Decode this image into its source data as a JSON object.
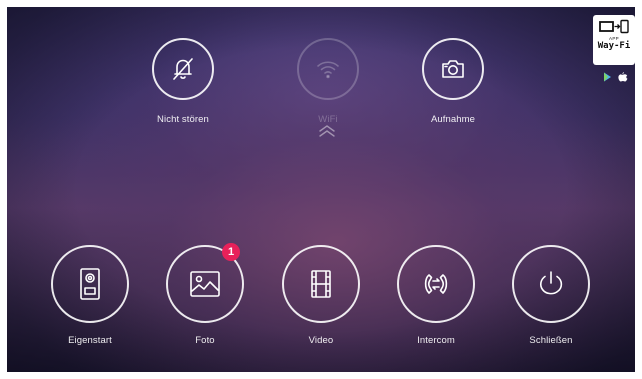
{
  "top_buttons": [
    {
      "label": "Nicht stören",
      "icon": "bell-off-icon",
      "enabled": true
    },
    {
      "label": "WiFi",
      "icon": "wifi-icon",
      "enabled": false
    },
    {
      "label": "Aufnahme",
      "icon": "camera-icon",
      "enabled": true
    }
  ],
  "bottom_buttons": [
    {
      "label": "Eigenstart",
      "icon": "door-station-icon"
    },
    {
      "label": "Foto",
      "icon": "image-icon",
      "badge": "1"
    },
    {
      "label": "Video",
      "icon": "film-icon"
    },
    {
      "label": "Intercom",
      "icon": "intercom-icon"
    },
    {
      "label": "Schließen",
      "icon": "power-icon"
    }
  ],
  "app_badge": {
    "caption": "APP",
    "name": "Way-Fi"
  },
  "colors": {
    "badge": "#e8215a",
    "ring": "#ffffff",
    "background_top": "#2f2a55",
    "background_mid": "#553a69"
  }
}
